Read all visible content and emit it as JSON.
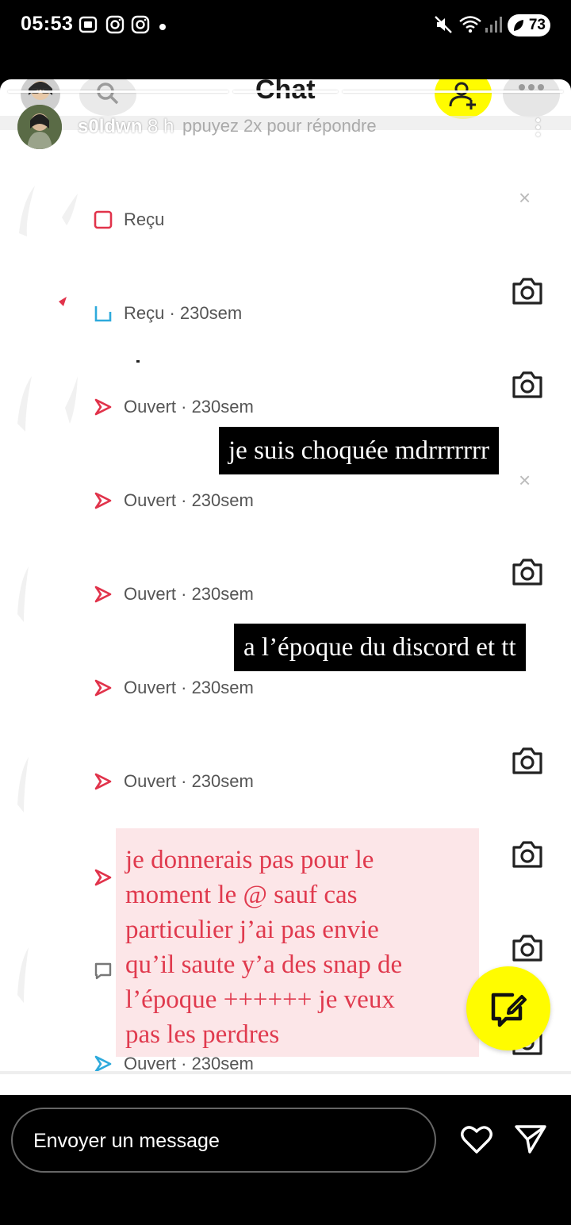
{
  "status_bar": {
    "time": "05:53",
    "battery": "73",
    "icons": [
      "screenshot-icon",
      "instagram-icon",
      "instagram-icon",
      "dot-icon",
      "mute-icon",
      "wifi-icon",
      "signal-icon",
      "battery-icon"
    ]
  },
  "snap_header": {
    "title": "Chat"
  },
  "story": {
    "username": "s0ldwn",
    "time_ago": "8 h",
    "hint": "ppuyez 2x pour répondre"
  },
  "chat_rows": [
    {
      "status": "Reçu",
      "icon": "received-chat-icon",
      "color": "#e1334b"
    },
    {
      "status": "Reçu · 230sem",
      "icon": "received-chat-icon",
      "color": "#2eaadc"
    },
    {
      "status": "Ouvert · 230sem",
      "icon": "opened-snap-icon",
      "color": "#e1334b"
    },
    {
      "status": "Ouvert · 230sem",
      "icon": "opened-snap-icon",
      "color": "#e1334b"
    },
    {
      "status": "Ouvert · 230sem",
      "icon": "opened-snap-icon",
      "color": "#e1334b"
    },
    {
      "status": "Ouvert · 230sem",
      "icon": "opened-snap-icon",
      "color": "#e1334b"
    },
    {
      "status": "Ouvert · 230sem",
      "icon": "opened-snap-icon",
      "color": "#e1334b"
    },
    {
      "status": "Ouvert · 230sem",
      "icon": "opened-chat-icon",
      "color": "#2eaadc"
    }
  ],
  "captions": {
    "first": "je suis choquée mdrrrrrrr",
    "second": "a l’époque du discord et tt",
    "third": "je donnerais pas pour le\nmoment le @ sauf cas\nparticulier j’ai pas envie\nqu’il saute y’a des snap de\nl’époque ++++++ je veux\npas les perdres"
  },
  "reply_bar": {
    "placeholder": "Envoyer un message"
  },
  "colors": {
    "snap_yellow": "#fffc00",
    "snap_red": "#e1334b",
    "snap_blue": "#2eaadc",
    "caption_pink_bg": "#fce6e8",
    "caption_pink_text": "#e03a4e"
  }
}
